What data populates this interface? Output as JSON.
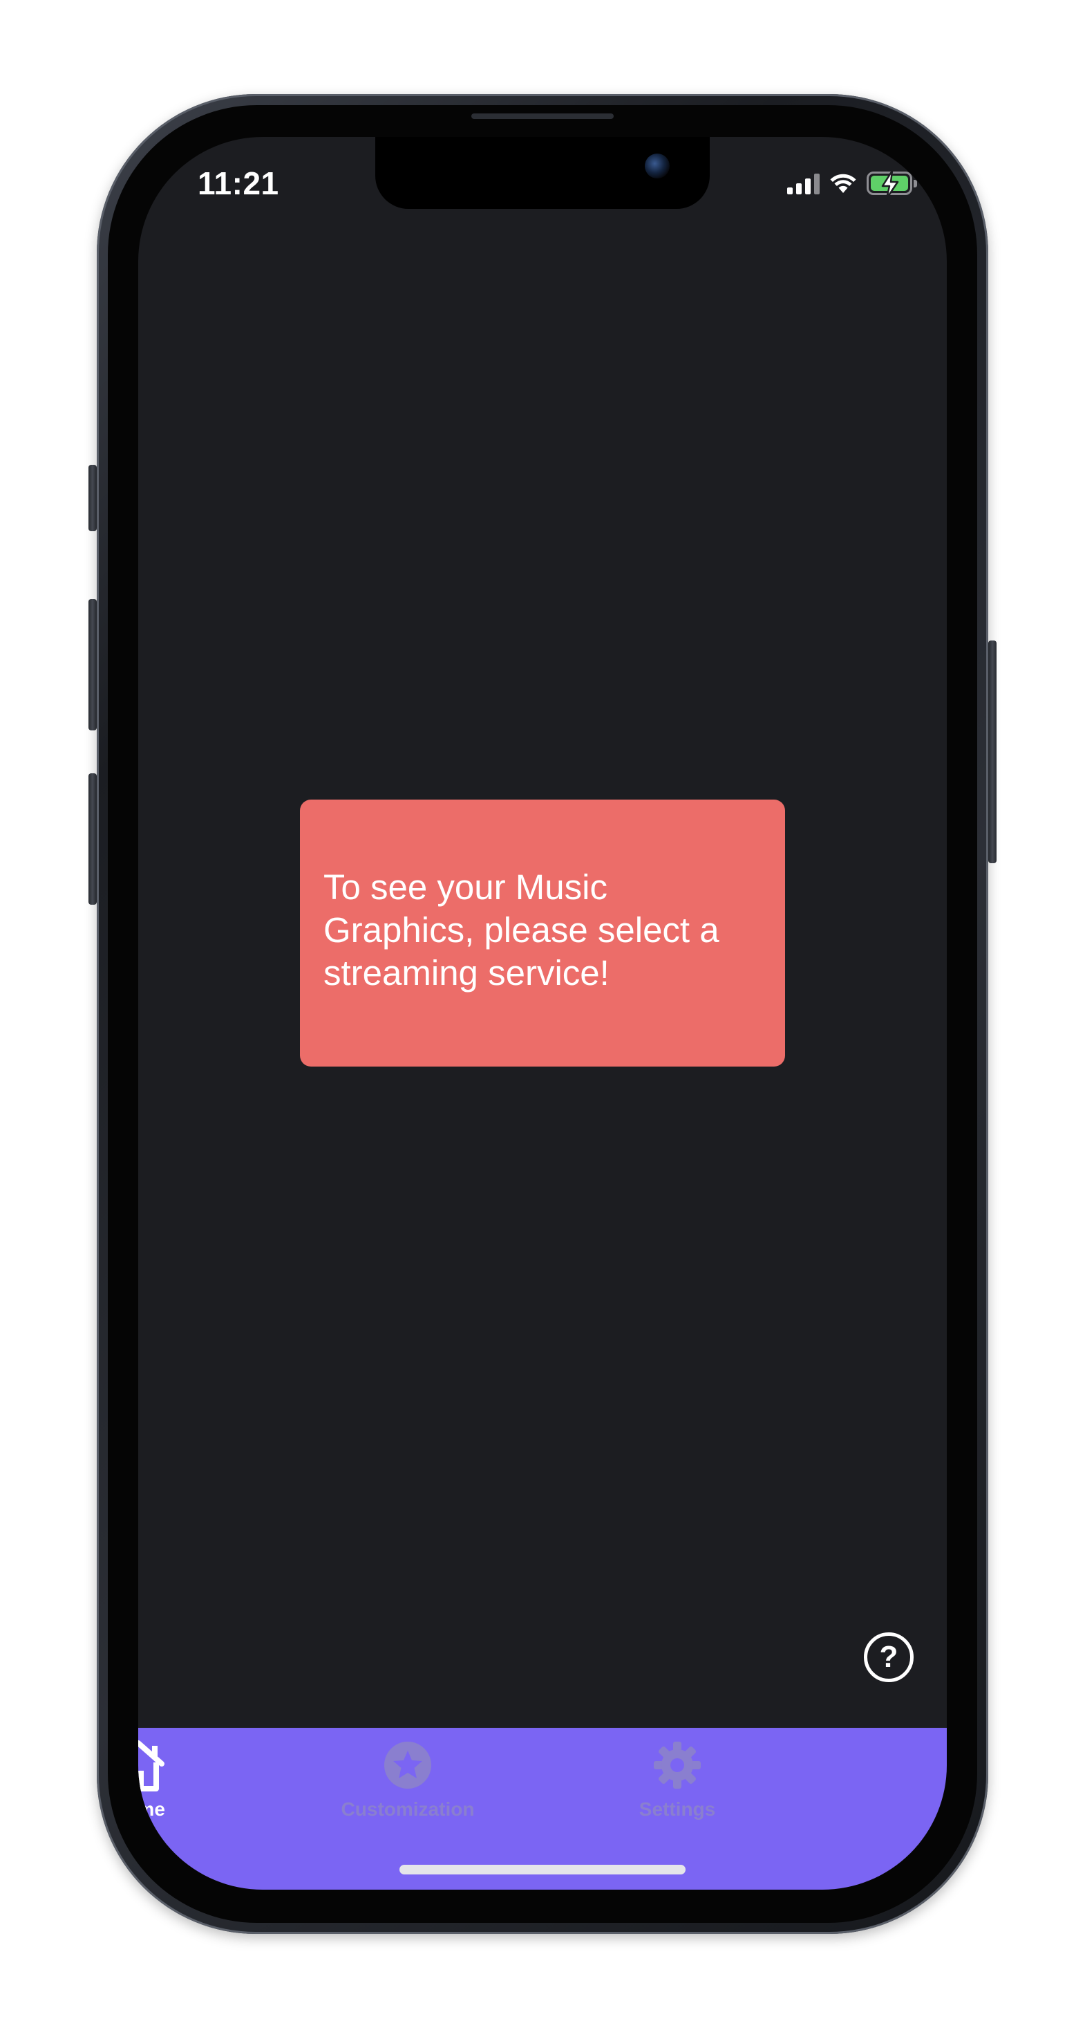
{
  "status_bar": {
    "time": "11:21",
    "icons": [
      "cellular-signal-icon",
      "wifi-icon",
      "battery-charging-icon"
    ]
  },
  "message": {
    "text": "To see your Music Graphics, please select a streaming service!",
    "background_color": "#ec6d69"
  },
  "help_button": {
    "symbol": "?",
    "icon": "question-circle-icon"
  },
  "tab_bar": {
    "background_color": "#7b65f3",
    "tabs": [
      {
        "label": "Home",
        "icon": "house-icon",
        "selected": true
      },
      {
        "label": "Customization",
        "icon": "star-circle-icon",
        "selected": false
      },
      {
        "label": "Settings",
        "icon": "gear-icon",
        "selected": false
      }
    ]
  },
  "colors": {
    "screen_background": "#1c1d21",
    "tab_active": "#ffffff",
    "tab_inactive": "#8a7fcf"
  }
}
